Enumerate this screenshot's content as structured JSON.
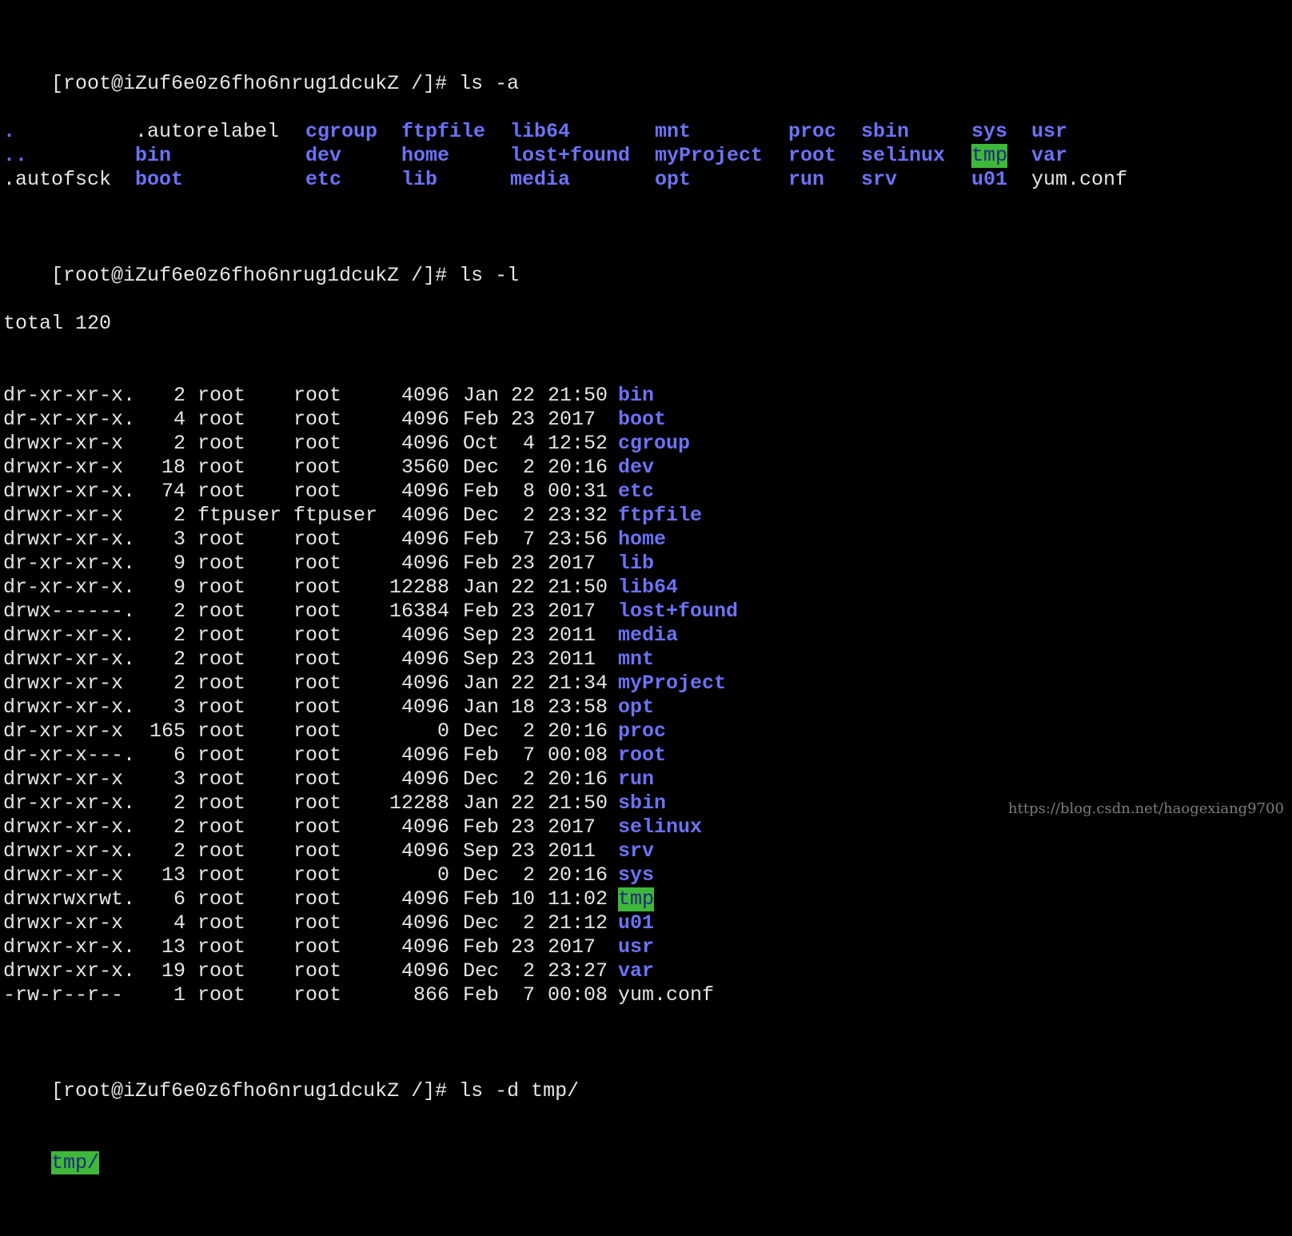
{
  "prompt": "[root@iZuf6e0z6fho6nrug1dcukZ /]#",
  "cmd1": "ls -a",
  "ls_a": {
    "row1": [
      ".",
      ".autorelabel",
      "cgroup",
      "ftpfile",
      "lib64",
      "mnt",
      "proc",
      "sbin",
      "sys",
      "usr"
    ],
    "row2": [
      "..",
      "bin",
      "dev",
      "home",
      "lost+found",
      "myProject",
      "root",
      "selinux",
      "tmp",
      "var"
    ],
    "row3": [
      ".autofsck",
      "boot",
      "etc",
      "lib",
      "media",
      "opt",
      "run",
      "srv",
      "u01",
      "yum.conf"
    ]
  },
  "cmd2": "ls -l",
  "total": "total 120",
  "rows": [
    {
      "perm": "dr-xr-xr-x.",
      "links": "2",
      "user": "root",
      "group": "root",
      "size": "4096",
      "mon": "Jan",
      "day": "22",
      "time": "21:50",
      "name": "bin",
      "kind": "dir"
    },
    {
      "perm": "dr-xr-xr-x.",
      "links": "4",
      "user": "root",
      "group": "root",
      "size": "4096",
      "mon": "Feb",
      "day": "23",
      "time": "2017",
      "name": "boot",
      "kind": "dir"
    },
    {
      "perm": "drwxr-xr-x",
      "links": "2",
      "user": "root",
      "group": "root",
      "size": "4096",
      "mon": "Oct",
      "day": "4",
      "time": "12:52",
      "name": "cgroup",
      "kind": "dir"
    },
    {
      "perm": "drwxr-xr-x",
      "links": "18",
      "user": "root",
      "group": "root",
      "size": "3560",
      "mon": "Dec",
      "day": "2",
      "time": "20:16",
      "name": "dev",
      "kind": "dir"
    },
    {
      "perm": "drwxr-xr-x.",
      "links": "74",
      "user": "root",
      "group": "root",
      "size": "4096",
      "mon": "Feb",
      "day": "8",
      "time": "00:31",
      "name": "etc",
      "kind": "dir"
    },
    {
      "perm": "drwxr-xr-x",
      "links": "2",
      "user": "ftpuser",
      "group": "ftpuser",
      "size": "4096",
      "mon": "Dec",
      "day": "2",
      "time": "23:32",
      "name": "ftpfile",
      "kind": "dir"
    },
    {
      "perm": "drwxr-xr-x.",
      "links": "3",
      "user": "root",
      "group": "root",
      "size": "4096",
      "mon": "Feb",
      "day": "7",
      "time": "23:56",
      "name": "home",
      "kind": "dir"
    },
    {
      "perm": "dr-xr-xr-x.",
      "links": "9",
      "user": "root",
      "group": "root",
      "size": "4096",
      "mon": "Feb",
      "day": "23",
      "time": "2017",
      "name": "lib",
      "kind": "dir"
    },
    {
      "perm": "dr-xr-xr-x.",
      "links": "9",
      "user": "root",
      "group": "root",
      "size": "12288",
      "mon": "Jan",
      "day": "22",
      "time": "21:50",
      "name": "lib64",
      "kind": "dir"
    },
    {
      "perm": "drwx------.",
      "links": "2",
      "user": "root",
      "group": "root",
      "size": "16384",
      "mon": "Feb",
      "day": "23",
      "time": "2017",
      "name": "lost+found",
      "kind": "dir"
    },
    {
      "perm": "drwxr-xr-x.",
      "links": "2",
      "user": "root",
      "group": "root",
      "size": "4096",
      "mon": "Sep",
      "day": "23",
      "time": "2011",
      "name": "media",
      "kind": "dir"
    },
    {
      "perm": "drwxr-xr-x.",
      "links": "2",
      "user": "root",
      "group": "root",
      "size": "4096",
      "mon": "Sep",
      "day": "23",
      "time": "2011",
      "name": "mnt",
      "kind": "dir"
    },
    {
      "perm": "drwxr-xr-x",
      "links": "2",
      "user": "root",
      "group": "root",
      "size": "4096",
      "mon": "Jan",
      "day": "22",
      "time": "21:34",
      "name": "myProject",
      "kind": "dir"
    },
    {
      "perm": "drwxr-xr-x.",
      "links": "3",
      "user": "root",
      "group": "root",
      "size": "4096",
      "mon": "Jan",
      "day": "18",
      "time": "23:58",
      "name": "opt",
      "kind": "dir"
    },
    {
      "perm": "dr-xr-xr-x",
      "links": "165",
      "user": "root",
      "group": "root",
      "size": "0",
      "mon": "Dec",
      "day": "2",
      "time": "20:16",
      "name": "proc",
      "kind": "dir"
    },
    {
      "perm": "dr-xr-x---.",
      "links": "6",
      "user": "root",
      "group": "root",
      "size": "4096",
      "mon": "Feb",
      "day": "7",
      "time": "00:08",
      "name": "root",
      "kind": "dir"
    },
    {
      "perm": "drwxr-xr-x",
      "links": "3",
      "user": "root",
      "group": "root",
      "size": "4096",
      "mon": "Dec",
      "day": "2",
      "time": "20:16",
      "name": "run",
      "kind": "dir"
    },
    {
      "perm": "dr-xr-xr-x.",
      "links": "2",
      "user": "root",
      "group": "root",
      "size": "12288",
      "mon": "Jan",
      "day": "22",
      "time": "21:50",
      "name": "sbin",
      "kind": "dir"
    },
    {
      "perm": "drwxr-xr-x.",
      "links": "2",
      "user": "root",
      "group": "root",
      "size": "4096",
      "mon": "Feb",
      "day": "23",
      "time": "2017",
      "name": "selinux",
      "kind": "dir"
    },
    {
      "perm": "drwxr-xr-x.",
      "links": "2",
      "user": "root",
      "group": "root",
      "size": "4096",
      "mon": "Sep",
      "day": "23",
      "time": "2011",
      "name": "srv",
      "kind": "dir"
    },
    {
      "perm": "drwxr-xr-x",
      "links": "13",
      "user": "root",
      "group": "root",
      "size": "0",
      "mon": "Dec",
      "day": "2",
      "time": "20:16",
      "name": "sys",
      "kind": "dir"
    },
    {
      "perm": "drwxrwxrwt.",
      "links": "6",
      "user": "root",
      "group": "root",
      "size": "4096",
      "mon": "Feb",
      "day": "10",
      "time": "11:02",
      "name": "tmp",
      "kind": "sticky"
    },
    {
      "perm": "drwxr-xr-x",
      "links": "4",
      "user": "root",
      "group": "root",
      "size": "4096",
      "mon": "Dec",
      "day": "2",
      "time": "21:12",
      "name": "u01",
      "kind": "dir"
    },
    {
      "perm": "drwxr-xr-x.",
      "links": "13",
      "user": "root",
      "group": "root",
      "size": "4096",
      "mon": "Feb",
      "day": "23",
      "time": "2017",
      "name": "usr",
      "kind": "dir"
    },
    {
      "perm": "drwxr-xr-x.",
      "links": "19",
      "user": "root",
      "group": "root",
      "size": "4096",
      "mon": "Dec",
      "day": "2",
      "time": "23:27",
      "name": "var",
      "kind": "dir"
    },
    {
      "perm": "-rw-r--r--",
      "links": "1",
      "user": "root",
      "group": "root",
      "size": "866",
      "mon": "Feb",
      "day": "7",
      "time": "00:08",
      "name": "yum.conf",
      "kind": "file"
    }
  ],
  "cmd3": "ls -d tmp/",
  "out3": "tmp/",
  "watermark": "https://blog.csdn.net/haogexiang9700",
  "colors": {
    "dir": "#6b73f7",
    "sticky_bg": "#3fb83a",
    "cursor": "#2b3bdc"
  }
}
